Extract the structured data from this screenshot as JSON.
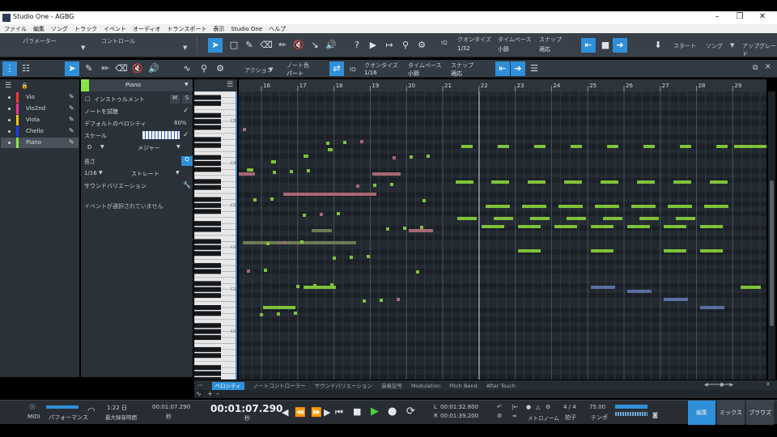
{
  "window": {
    "title": "Studio One - AGBG"
  },
  "menu": [
    "ファイル",
    "編集",
    "ソング",
    "トラック",
    "イベント",
    "オーディオ",
    "トランスポート",
    "表示",
    "Studio One",
    "ヘルプ"
  ],
  "maintoolbar": {
    "param_label": "パラメーター",
    "control_label": "コントロール",
    "quantize_label": "クオンタイズ",
    "quantize_value": "1/32",
    "timebase_label": "タイムベース",
    "timebase_value": "小節",
    "snap_label": "スナップ",
    "snap_value": "適応",
    "start_label": "スタート",
    "song_label": "ソング",
    "arranger_label": "アップグレード",
    "iq_label": "IQ"
  },
  "editortoolbar": {
    "action_label": "アクション",
    "notecolor_label": "ノート色",
    "notecolor_value": "パート",
    "quantize_label": "クオンタイズ",
    "quantize_value": "1/16",
    "timebase_label": "タイムベース",
    "timebase_value": "小節",
    "snap_label": "スナップ",
    "snap_value": "適応",
    "iq_label": "IQ"
  },
  "tracks": [
    {
      "name": "Vio",
      "color": "#e63b3b"
    },
    {
      "name": "Vio2nd",
      "color": "#e63b8a"
    },
    {
      "name": "Viola",
      "color": "#e6c419"
    },
    {
      "name": "Chello",
      "color": "#1f3fe0"
    },
    {
      "name": "Piano",
      "color": "#8be34a"
    }
  ],
  "inspector": {
    "instrument_name": "Piano",
    "instrument_label": "インストゥルメント",
    "mute": "M",
    "solo": "S",
    "note_preview": "ノートを試聴",
    "default_velocity_label": "デフォルトのベロシティ",
    "default_velocity": "80%",
    "scale_label": "スケール",
    "scale_root": "D",
    "scale_type": "メジャー",
    "length_label": "長さ",
    "length_value": "1/16",
    "length_mode": "ストレート",
    "sound_variation": "サウンドバリエーション",
    "no_event": "イベントが選択されていません"
  },
  "ruler": [
    "16",
    "17",
    "18",
    "19",
    "20",
    "21",
    "22",
    "23",
    "24",
    "25",
    "26",
    "27",
    "28",
    "29"
  ],
  "key_labels": [
    "C5",
    "C4",
    "C3",
    "C2",
    "C1",
    "C0"
  ],
  "lanes": [
    "ベロシティ",
    "ノートコントローラー",
    "サウンドバリエーション",
    "演奏記号",
    "Modulation",
    "Pitch Bend",
    "After Touch"
  ],
  "transport": {
    "midi": "MIDI",
    "performance": "パフォーマンス",
    "rec_time": "1:22 日",
    "rec_time_label": "最大録音時間",
    "time_small": "00:01:07.290",
    "time_small_unit": "秒",
    "time_big": "00:01:07.290",
    "time_big_unit": "秒",
    "loop_l": "00:01:32.800",
    "loop_r": "00:01:39.200",
    "metronome_label": "メトロノーム",
    "signature": "4 / 4",
    "signature_label": "拍子",
    "tempo": "75.00",
    "tempo_label": "テンポ",
    "view_edit": "編集",
    "view_mix": "ミックス",
    "view_browse": "ブラウズ"
  },
  "colors": {
    "accent": "#2f8fd8",
    "note_green": "#7fc23a",
    "note_pink": "#a86874",
    "note_blue": "#5a6fa0"
  }
}
